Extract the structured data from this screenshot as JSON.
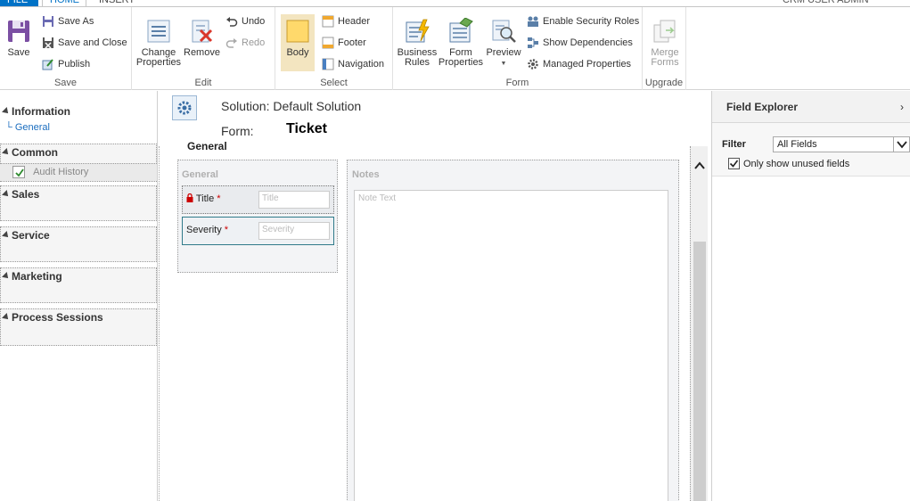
{
  "tabs": {
    "file": "FILE",
    "home": "HOME",
    "insert": "INSERT",
    "user": "CRM USER ADMIN"
  },
  "ribbon": {
    "save_group": {
      "label": "Save",
      "save": "Save",
      "save_as": "Save As",
      "save_and_close": "Save and Close",
      "publish": "Publish"
    },
    "edit_group": {
      "label": "Edit",
      "change_properties_line1": "Change",
      "change_properties_line2": "Properties",
      "remove": "Remove",
      "undo": "Undo",
      "redo": "Redo"
    },
    "select_group": {
      "label": "Select",
      "body": "Body",
      "header": "Header",
      "footer": "Footer",
      "navigation": "Navigation"
    },
    "form_group": {
      "label": "Form",
      "business_rules_line1": "Business",
      "business_rules_line2": "Rules",
      "form_properties_line1": "Form",
      "form_properties_line2": "Properties",
      "preview": "Preview",
      "enable_security_roles": "Enable Security Roles",
      "show_dependencies": "Show Dependencies",
      "managed_properties": "Managed Properties"
    },
    "upgrade_group": {
      "label": "Upgrade",
      "merge_forms_line1": "Merge",
      "merge_forms_line2": "Forms"
    }
  },
  "leftnav": {
    "information": "Information",
    "general": "General",
    "common": "Common",
    "audit_history": "Audit History",
    "sales": "Sales",
    "service": "Service",
    "marketing": "Marketing",
    "process_sessions": "Process Sessions"
  },
  "header": {
    "solution_label": "Solution:",
    "solution_name": "Default Solution",
    "form_label": "Form:",
    "form_name": "Ticket"
  },
  "canvas": {
    "tab_title": "General",
    "general_section": "General",
    "notes_section": "Notes",
    "fields": [
      {
        "label": "Title",
        "placeholder": "Title",
        "required": "*"
      },
      {
        "label": "Severity",
        "placeholder": "Severity",
        "required": "*"
      }
    ],
    "notes_placeholder": "Note Text"
  },
  "explorer": {
    "title": "Field Explorer",
    "filter_label": "Filter",
    "filter_value": "All Fields",
    "only_unused_label": "Only show unused fields",
    "only_unused_checked": true
  },
  "colors": {
    "accent": "#0072c6",
    "selected_field_border": "#2f7a8a",
    "required": "#cc0000"
  }
}
